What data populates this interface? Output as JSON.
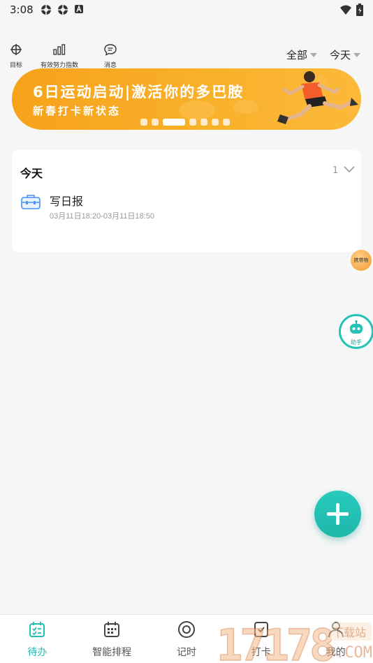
{
  "status_bar": {
    "time": "3:08",
    "notification_icons": [
      "settings-gear-icon",
      "settings-gear-icon",
      "a-letter-icon"
    ],
    "system_icons": [
      "wifi-icon",
      "battery-icon"
    ]
  },
  "top_bar": {
    "buttons": [
      {
        "label": "目标",
        "icon": "crosshair-target-icon"
      },
      {
        "label": "有效努力指数",
        "icon": "bar-chart-icon"
      },
      {
        "label": "消息",
        "icon": "message-bubble-icon"
      }
    ],
    "filters": {
      "scope": "全部",
      "date": "今天"
    }
  },
  "banner": {
    "headline": "6日运动启动|激活你的多巴胺",
    "subline": "新春打卡新状态",
    "slide_count": 7,
    "active_slide": 3,
    "colors": {
      "background": "#f9ab25",
      "text": "#ffffff"
    }
  },
  "today_card": {
    "title": "今天",
    "count": "1",
    "tasks": [
      {
        "name": "写日报",
        "time_range": "03月11日18:20-03月11日18:50",
        "icon": "briefcase-icon"
      }
    ]
  },
  "floating": {
    "carry_label": "携带物",
    "assistant_label": "助手"
  },
  "tab_bar": {
    "accent_color": "#20bfb1",
    "tabs": [
      {
        "label": "待办",
        "icon": "todo-calendar-check-icon",
        "active": true
      },
      {
        "label": "智能排程",
        "icon": "schedule-grid-icon",
        "active": false
      },
      {
        "label": "记时",
        "icon": "timer-circle-icon",
        "active": false
      },
      {
        "label": "打卡",
        "icon": "checkin-icon",
        "active": false
      },
      {
        "label": "我的",
        "icon": "profile-person-icon",
        "active": false
      }
    ]
  },
  "watermark": {
    "digits": "17178",
    "tag": "下载站",
    "domain": "COM"
  }
}
